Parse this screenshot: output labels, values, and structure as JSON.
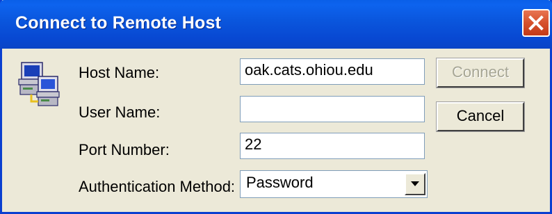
{
  "window": {
    "title": "Connect to Remote Host",
    "colors": {
      "titlebar": "#0a55dc",
      "close_button": "#d6512c",
      "dialog_bg": "#ece9d8"
    }
  },
  "icons": {
    "title_close": "close-icon",
    "app": "networked-computers-icon",
    "dropdown": "chevron-down-icon"
  },
  "form": {
    "host_name_label": "Host Name:",
    "host_name_value": "oak.cats.ohiou.edu",
    "user_name_label": "User Name:",
    "user_name_value": "",
    "port_number_label": "Port Number:",
    "port_number_value": "22",
    "auth_method_label": "Authentication Method:",
    "auth_method_value": "Password"
  },
  "buttons": {
    "connect_label": "Connect",
    "connect_enabled": false,
    "cancel_label": "Cancel"
  }
}
